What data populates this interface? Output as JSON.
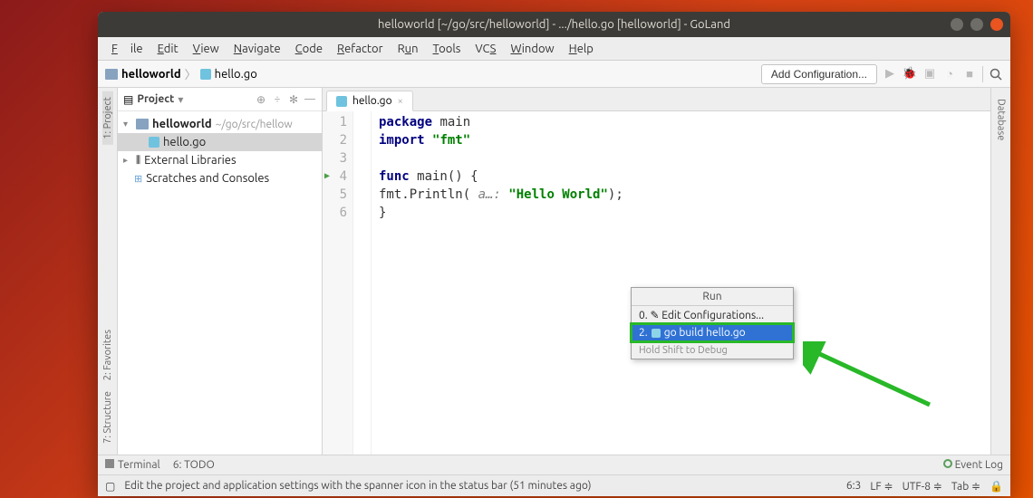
{
  "titlebar": {
    "title": "helloworld [~/go/src/helloworld] - .../hello.go [helloworld] - GoLand"
  },
  "menubar": {
    "file": "File",
    "edit": "Edit",
    "view": "View",
    "navigate": "Navigate",
    "code": "Code",
    "refactor": "Refactor",
    "run": "Run",
    "tools": "Tools",
    "vcs": "VCS",
    "window": "Window",
    "help": "Help"
  },
  "breadcrumb": {
    "project": "helloworld",
    "file": "hello.go"
  },
  "navbar": {
    "add_configuration": "Add Configuration..."
  },
  "left_tabs": {
    "project": "1: Project",
    "favorites": "2: Favorites",
    "structure": "7: Structure"
  },
  "right_tabs": {
    "database": "Database"
  },
  "project_panel": {
    "title": "Project",
    "root": "helloworld",
    "root_path": "~/go/src/hellow",
    "file": "hello.go",
    "libs": "External Libraries",
    "scratches": "Scratches and Consoles"
  },
  "tab": {
    "file": "hello.go"
  },
  "code": {
    "l1_kw1": "package",
    "l1_id": " main",
    "l2_kw1": "import",
    "l2_str": "\"fmt\"",
    "l4_kw1": "func",
    "l4_id": " main() {",
    "l5_pre": "    fmt.Println( ",
    "l5_param": "a…:",
    "l5_str": " \"Hello World\"",
    "l5_post": ");",
    "l6": "}"
  },
  "gutter": {
    "l1": "1",
    "l2": "2",
    "l3": "3",
    "l4": "4",
    "l5": "5",
    "l6": "6"
  },
  "popup": {
    "title": "Run",
    "item0": "0. ✎ Edit Configurations...",
    "item2_prefix": "2. ",
    "item2_label": "go build hello.go",
    "footer": "Hold Shift to Debug"
  },
  "bottombar": {
    "terminal": "Terminal",
    "todo": "6: TODO",
    "eventlog": "Event Log"
  },
  "statusbar": {
    "tip": "Edit the project and application settings with the spanner icon in the status bar (51 minutes ago)",
    "pos": "6:3",
    "lf": "LF",
    "enc": "UTF-8",
    "tab": "Tab"
  }
}
